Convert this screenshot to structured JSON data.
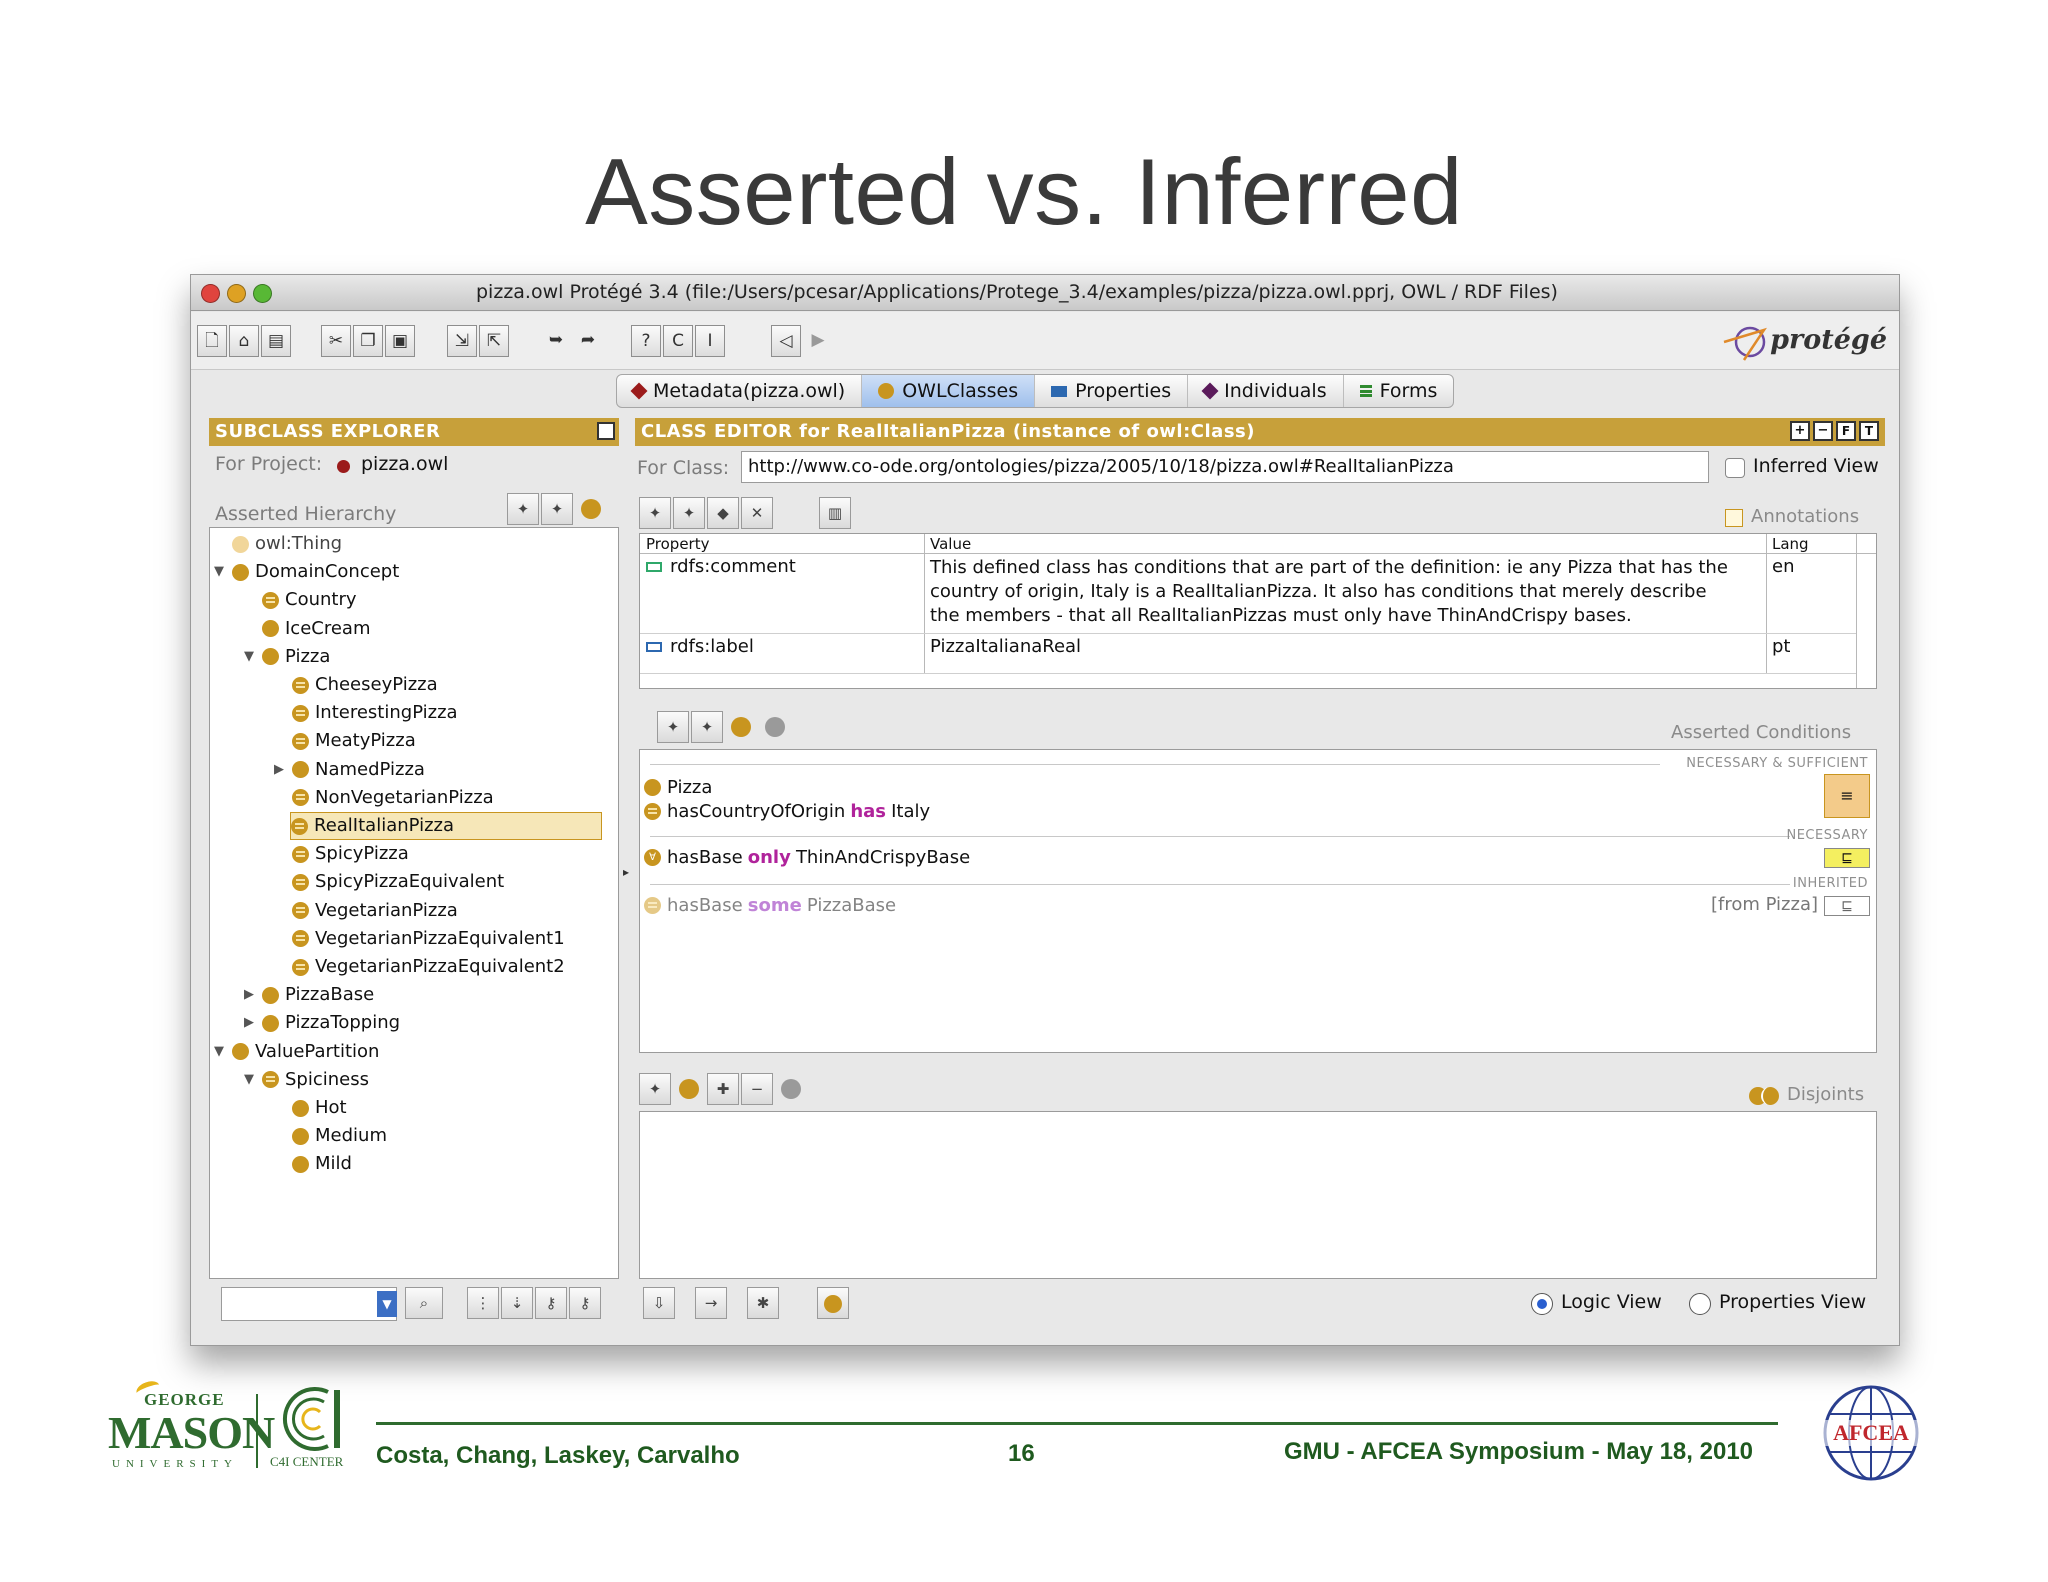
{
  "slide": {
    "title": "Asserted vs. Inferred"
  },
  "window": {
    "title": "pizza.owl   Protégé 3.4     (file:/Users/pcesar/Applications/Protege_3.4/examples/pizza/pizza.owl.pprj, OWL / RDF Files)",
    "logo": "protégé"
  },
  "tabs": [
    {
      "label": "Metadata(pizza.owl)",
      "icon": "diamond-icon",
      "color": "#9b1b1b"
    },
    {
      "label": "OWLClasses",
      "icon": "class-icon",
      "color": "#c8951f",
      "selected": true
    },
    {
      "label": "Properties",
      "icon": "property-icon",
      "color": "#2c68b0"
    },
    {
      "label": "Individuals",
      "icon": "individual-icon",
      "color": "#5a1a5a"
    },
    {
      "label": "Forms",
      "icon": "forms-icon",
      "color": "#2f8a2f"
    }
  ],
  "subclass_explorer": {
    "header": "SUBCLASS EXPLORER",
    "project_label": "For Project:",
    "project_name": "pizza.owl",
    "hierarchy_label": "Asserted Hierarchy",
    "tree": [
      {
        "label": "owl:Thing",
        "kind": "thing",
        "level": 0,
        "arrow": ""
      },
      {
        "label": "DomainConcept",
        "kind": "class",
        "level": 0,
        "arrow": "▼"
      },
      {
        "label": "Country",
        "kind": "defined",
        "level": 1,
        "arrow": ""
      },
      {
        "label": "IceCream",
        "kind": "class",
        "level": 1,
        "arrow": ""
      },
      {
        "label": "Pizza",
        "kind": "class",
        "level": 1,
        "arrow": "▼"
      },
      {
        "label": "CheeseyPizza",
        "kind": "defined",
        "level": 2,
        "arrow": ""
      },
      {
        "label": "InterestingPizza",
        "kind": "defined",
        "level": 2,
        "arrow": ""
      },
      {
        "label": "MeatyPizza",
        "kind": "defined",
        "level": 2,
        "arrow": ""
      },
      {
        "label": "NamedPizza",
        "kind": "class",
        "level": 2,
        "arrow": "▶"
      },
      {
        "label": "NonVegetarianPizza",
        "kind": "defined",
        "level": 2,
        "arrow": ""
      },
      {
        "label": "RealItalianPizza",
        "kind": "defined",
        "level": 2,
        "arrow": "",
        "selected": true
      },
      {
        "label": "SpicyPizza",
        "kind": "defined",
        "level": 2,
        "arrow": ""
      },
      {
        "label": "SpicyPizzaEquivalent",
        "kind": "defined",
        "level": 2,
        "arrow": ""
      },
      {
        "label": "VegetarianPizza",
        "kind": "defined",
        "level": 2,
        "arrow": ""
      },
      {
        "label": "VegetarianPizzaEquivalent1",
        "kind": "defined",
        "level": 2,
        "arrow": ""
      },
      {
        "label": "VegetarianPizzaEquivalent2",
        "kind": "defined",
        "level": 2,
        "arrow": ""
      },
      {
        "label": "PizzaBase",
        "kind": "class",
        "level": 1,
        "arrow": "▶"
      },
      {
        "label": "PizzaTopping",
        "kind": "class",
        "level": 1,
        "arrow": "▶"
      },
      {
        "label": "ValuePartition",
        "kind": "class",
        "level": 0,
        "arrow": "▼"
      },
      {
        "label": "Spiciness",
        "kind": "defined",
        "level": 1,
        "arrow": "▼"
      },
      {
        "label": "Hot",
        "kind": "class",
        "level": 2,
        "arrow": ""
      },
      {
        "label": "Medium",
        "kind": "class",
        "level": 2,
        "arrow": ""
      },
      {
        "label": "Mild",
        "kind": "class",
        "level": 2,
        "arrow": ""
      }
    ]
  },
  "class_editor": {
    "header": "CLASS EDITOR for RealItalianPizza   (instance of owl:Class)",
    "for_class_label": "For Class:",
    "for_class_value": "http://www.co-ode.org/ontologies/pizza/2005/10/18/pizza.owl#RealItalianPizza",
    "inferred_view_label": "Inferred View",
    "annotations_label": "Annotations",
    "columns": {
      "property": "Property",
      "value": "Value",
      "lang": "Lang"
    },
    "annotations": [
      {
        "property": "rdfs:comment",
        "value_lines": [
          "This defined class has conditions that are part of the definition: ie any Pizza that has the",
          "country of origin, Italy is a RealItalianPizza. It also has conditions that merely describe",
          "the members - that all RealItalianPizzas must only have ThinAndCrispy bases."
        ],
        "lang": "en"
      },
      {
        "property": "rdfs:label",
        "value_lines": [
          "PizzaItalianaReal"
        ],
        "lang": "pt"
      }
    ],
    "asserted_conditions_label": "Asserted Conditions",
    "necessary_sufficient_label": "NECESSARY & SUFFICIENT",
    "necessary_label": "NECESSARY",
    "inherited_label": "INHERITED",
    "conditions": {
      "ns_1": "Pizza",
      "ns_2_prop": "hasCountryOfOrigin",
      "ns_2_kw": "has",
      "ns_2_val": "Italy",
      "nec_prop": "hasBase",
      "nec_kw": "only",
      "nec_val": "ThinAndCrispyBase",
      "inh_prop": "hasBase",
      "inh_kw": "some",
      "inh_val": "PizzaBase",
      "inh_from": "[from Pizza]",
      "equiv_symbol": "≡",
      "subset_symbol": "⊑"
    },
    "disjoints_label": "Disjoints",
    "logic_view_label": "Logic View",
    "properties_view_label": "Properties View"
  },
  "footer": {
    "authors": "Costa, Chang, Laskey, Carvalho",
    "page": "16",
    "event": "GMU - AFCEA Symposium - May 18, 2010",
    "gmu_george": "GEORGE",
    "gmu_mason": "MASON",
    "gmu_university": "UNIVERSITY",
    "c4i": "C4I CENTER",
    "afcea": "AFCEA"
  }
}
